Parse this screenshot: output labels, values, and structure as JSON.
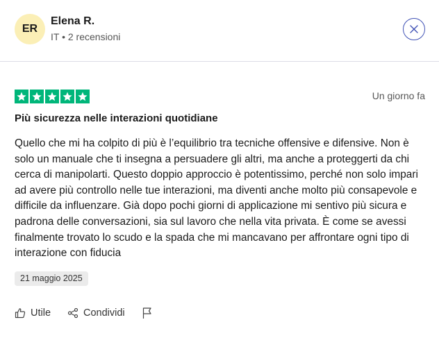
{
  "reviewer": {
    "initials": "ER",
    "name": "Elena R.",
    "meta": "IT • 2 recensioni"
  },
  "review": {
    "rating": 5,
    "time_ago": "Un giorno fa",
    "title": "Più sicurezza nelle interazioni quotidiane",
    "text": "Quello che mi ha colpito di più è l’equilibrio tra tecniche offensive e difensive. Non è solo un manuale che ti insegna a persuadere gli altri, ma anche a proteggerti da chi cerca di manipolarti. Questo doppio approccio è potentissimo, perché non solo impari ad avere più controllo nelle tue interazioni, ma diventi anche molto più consapevole e difficile da influenzare. Già dopo pochi giorni di applicazione mi sentivo più sicura e padrona delle conversazioni, sia sul lavoro che nella vita privata. È come se avessi finalmente trovato lo scudo e la spada che mi mancavano per affrontare ogni tipo di interazione con fiducia",
    "experience_date": "21 maggio 2025"
  },
  "actions": {
    "useful_label": "Utile",
    "share_label": "Condividi"
  },
  "colors": {
    "star_green": "#00b67a",
    "avatar_bg": "#fbefb6",
    "close_accent": "#3f51b5"
  },
  "icons": [
    "close-icon",
    "star-icon",
    "thumbs-up-icon",
    "share-icon",
    "flag-icon"
  ]
}
